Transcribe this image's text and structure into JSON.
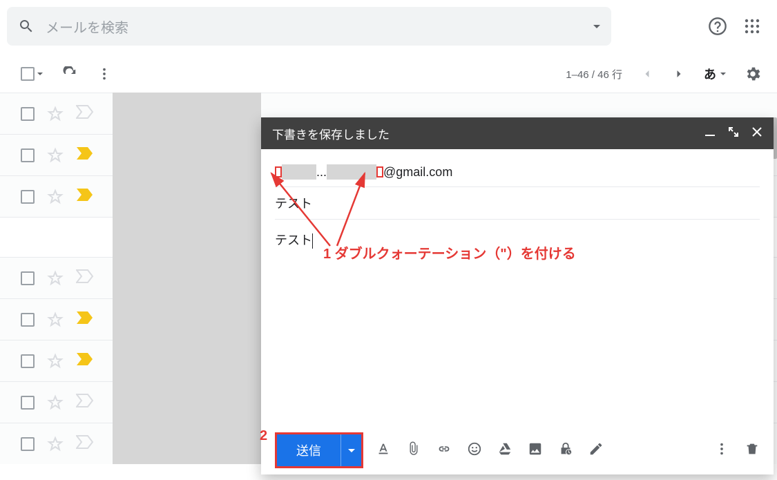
{
  "search": {
    "placeholder": "メールを検索"
  },
  "toolbar": {
    "range": "1–46 / 46 行",
    "lang": "あ"
  },
  "compose": {
    "title": "下書きを保存しました",
    "recipient_suffix": "@gmail.com",
    "recipient_masked_dots": "...",
    "subject": "テスト",
    "body": "テスト",
    "send_label": "送信"
  },
  "annotations": {
    "step1": "1 ダブルクォーテーション（\"）を付ける",
    "step2": "2"
  }
}
